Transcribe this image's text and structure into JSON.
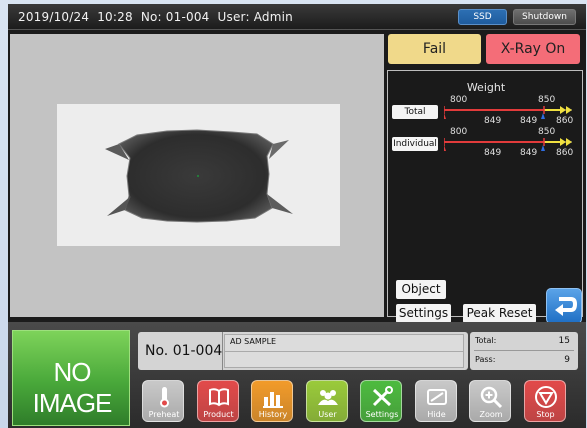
{
  "topbar": {
    "datetime": "2019/10/24  10:28",
    "number": "No: 01-004",
    "user": "User: Admin",
    "ssd_label": "SSD",
    "shutdown_label": "Shutdown"
  },
  "status": {
    "fail_label": "Fail",
    "xray_label": "X-Ray On",
    "fail_color": "#f0d98a",
    "xray_color": "#f46d78"
  },
  "weight": {
    "title": "Weight",
    "total": {
      "button_label": "Total",
      "low_label": "800",
      "high_label": "850",
      "values": [
        "849",
        "849",
        "860"
      ]
    },
    "individual": {
      "button_label": "Individual",
      "low_label": "800",
      "high_label": "850",
      "values": [
        "849",
        "849",
        "860"
      ]
    }
  },
  "panel_buttons": {
    "object_label": "Object",
    "settings_label": "Settings",
    "peak_reset_label": "Peak Reset"
  },
  "thumbnail": {
    "text": "NO IMAGE"
  },
  "product": {
    "number": "No. 01-004",
    "name": "AD SAMPLE"
  },
  "counts": {
    "total_label": "Total:",
    "total_value": "15",
    "pass_label": "Pass:",
    "pass_value": "9"
  },
  "toolbar": [
    {
      "label": "Preheat",
      "icon": "thermometer-icon",
      "color": "#c9c9c9"
    },
    {
      "label": "Product",
      "icon": "book-icon",
      "color": "#e24a4a"
    },
    {
      "label": "History",
      "icon": "bar-chart-icon",
      "color": "#f29b2a"
    },
    {
      "label": "User",
      "icon": "users-icon",
      "color": "#9acb3a"
    },
    {
      "label": "Settings",
      "icon": "tools-icon",
      "color": "#4dbb3f"
    },
    {
      "label": "Hide",
      "icon": "hide-icon",
      "color": "#c9c9c9"
    },
    {
      "label": "Zoom",
      "icon": "zoom-icon",
      "color": "#c9c9c9"
    },
    {
      "label": "Stop",
      "icon": "stop-icon",
      "color": "#e24a4a"
    }
  ]
}
